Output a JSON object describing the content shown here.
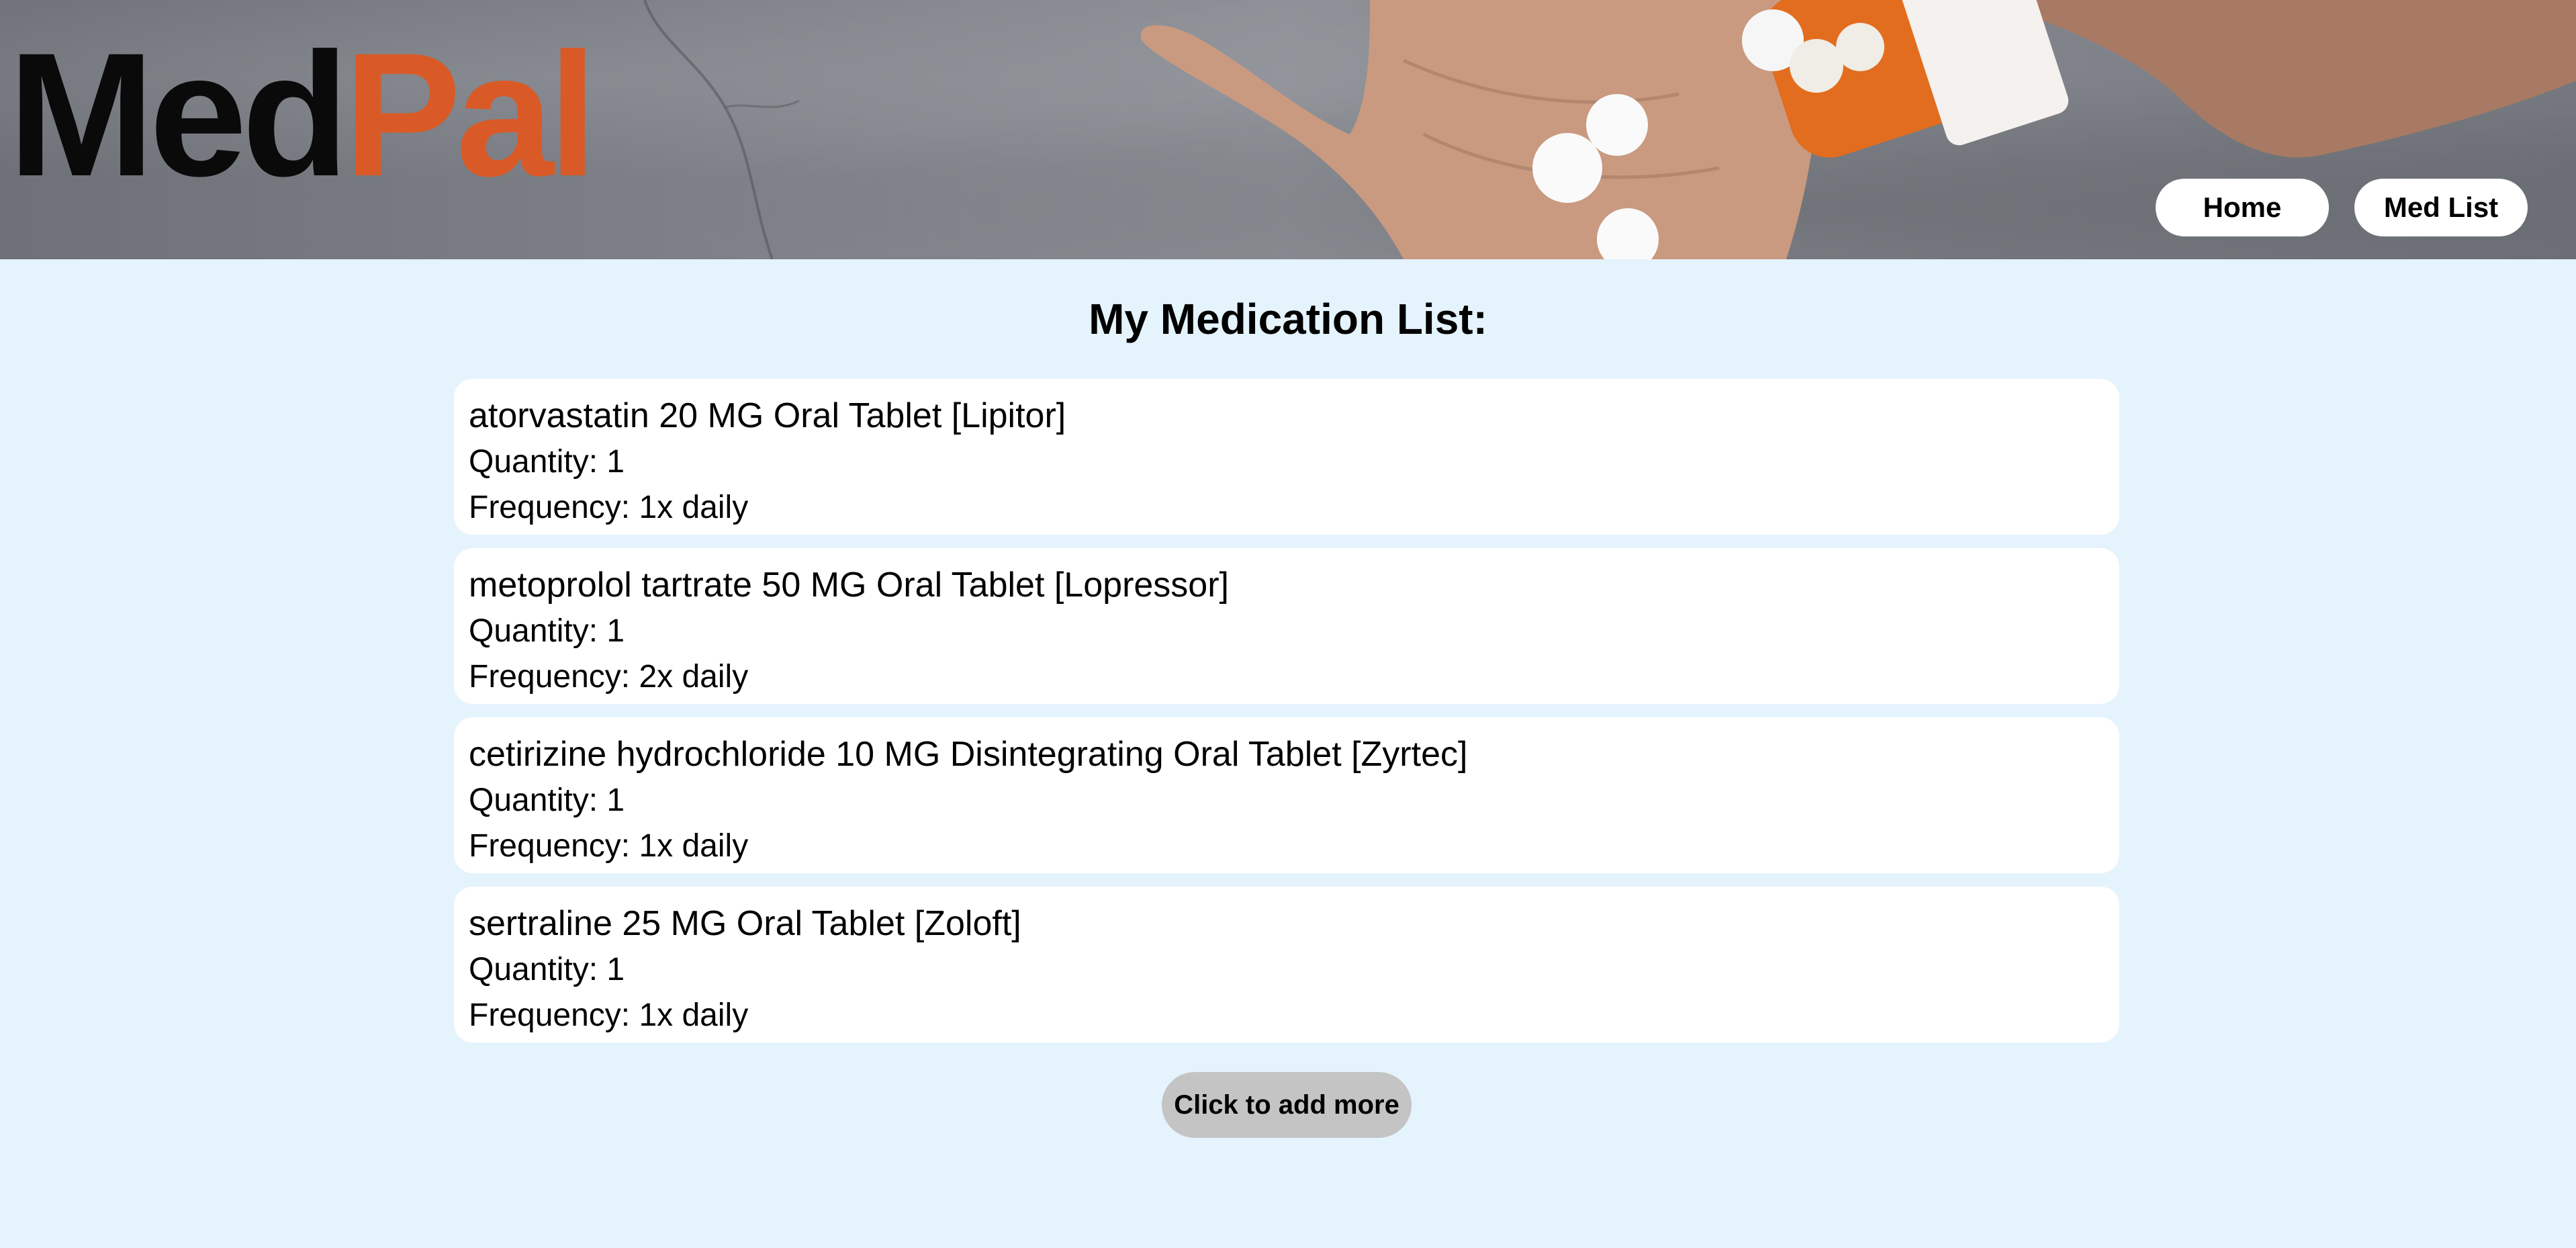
{
  "header": {
    "logo_part1": "Med",
    "logo_part2": "Pal",
    "nav": {
      "home": "Home",
      "med_list": "Med List"
    }
  },
  "main": {
    "title": "My Medication List:",
    "medications": [
      {
        "name": "atorvastatin 20 MG Oral Tablet [Lipitor]",
        "quantity": "Quantity: 1",
        "frequency": "Frequency: 1x daily"
      },
      {
        "name": "metoprolol tartrate 50 MG Oral Tablet [Lopressor]",
        "quantity": "Quantity: 1",
        "frequency": "Frequency: 2x daily"
      },
      {
        "name": "cetirizine hydrochloride 10 MG Disintegrating Oral Tablet [Zyrtec]",
        "quantity": "Quantity: 1",
        "frequency": "Frequency: 1x daily"
      },
      {
        "name": "sertraline 25 MG Oral Tablet [Zoloft]",
        "quantity": "Quantity: 1",
        "frequency": "Frequency: 1x daily"
      }
    ],
    "add_button": "Click to add more"
  },
  "colors": {
    "background": "#e5f3fc",
    "accent": "#d95a26",
    "card": "#ffffff",
    "add_button": "#c4c4c4"
  }
}
